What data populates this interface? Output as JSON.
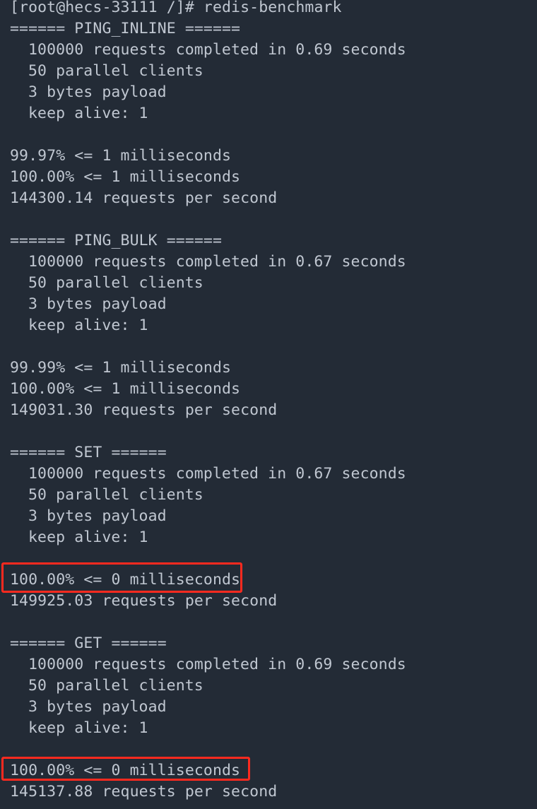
{
  "prompt": "[root@hecs-33111 /]# redis-benchmark",
  "sections": [
    {
      "header": "====== PING_INLINE ======",
      "requests_completed": "100000 requests completed in 0.69 seconds",
      "parallel_clients": "50 parallel clients",
      "payload": "3 bytes payload",
      "keep_alive": "keep alive: 1",
      "latency": [
        "99.97% <= 1 milliseconds",
        "100.00% <= 1 milliseconds"
      ],
      "rps": "144300.14 requests per second"
    },
    {
      "header": "====== PING_BULK ======",
      "requests_completed": "100000 requests completed in 0.67 seconds",
      "parallel_clients": "50 parallel clients",
      "payload": "3 bytes payload",
      "keep_alive": "keep alive: 1",
      "latency": [
        "99.99% <= 1 milliseconds",
        "100.00% <= 1 milliseconds"
      ],
      "rps": "149031.30 requests per second"
    },
    {
      "header": "====== SET ======",
      "requests_completed": "100000 requests completed in 0.67 seconds",
      "parallel_clients": "50 parallel clients",
      "payload": "3 bytes payload",
      "keep_alive": "keep alive: 1",
      "latency": [
        "100.00% <= 0 milliseconds"
      ],
      "rps": "149925.03 requests per second"
    },
    {
      "header": "====== GET ======",
      "requests_completed": "100000 requests completed in 0.69 seconds",
      "parallel_clients": "50 parallel clients",
      "payload": "3 bytes payload",
      "keep_alive": "keep alive: 1",
      "latency": [
        "100.00% <= 0 milliseconds"
      ],
      "rps": "145137.88 requests per second"
    }
  ],
  "colors": {
    "background": "#232b36",
    "text": "#c0c7d1",
    "highlight": "#ff2a1f"
  }
}
